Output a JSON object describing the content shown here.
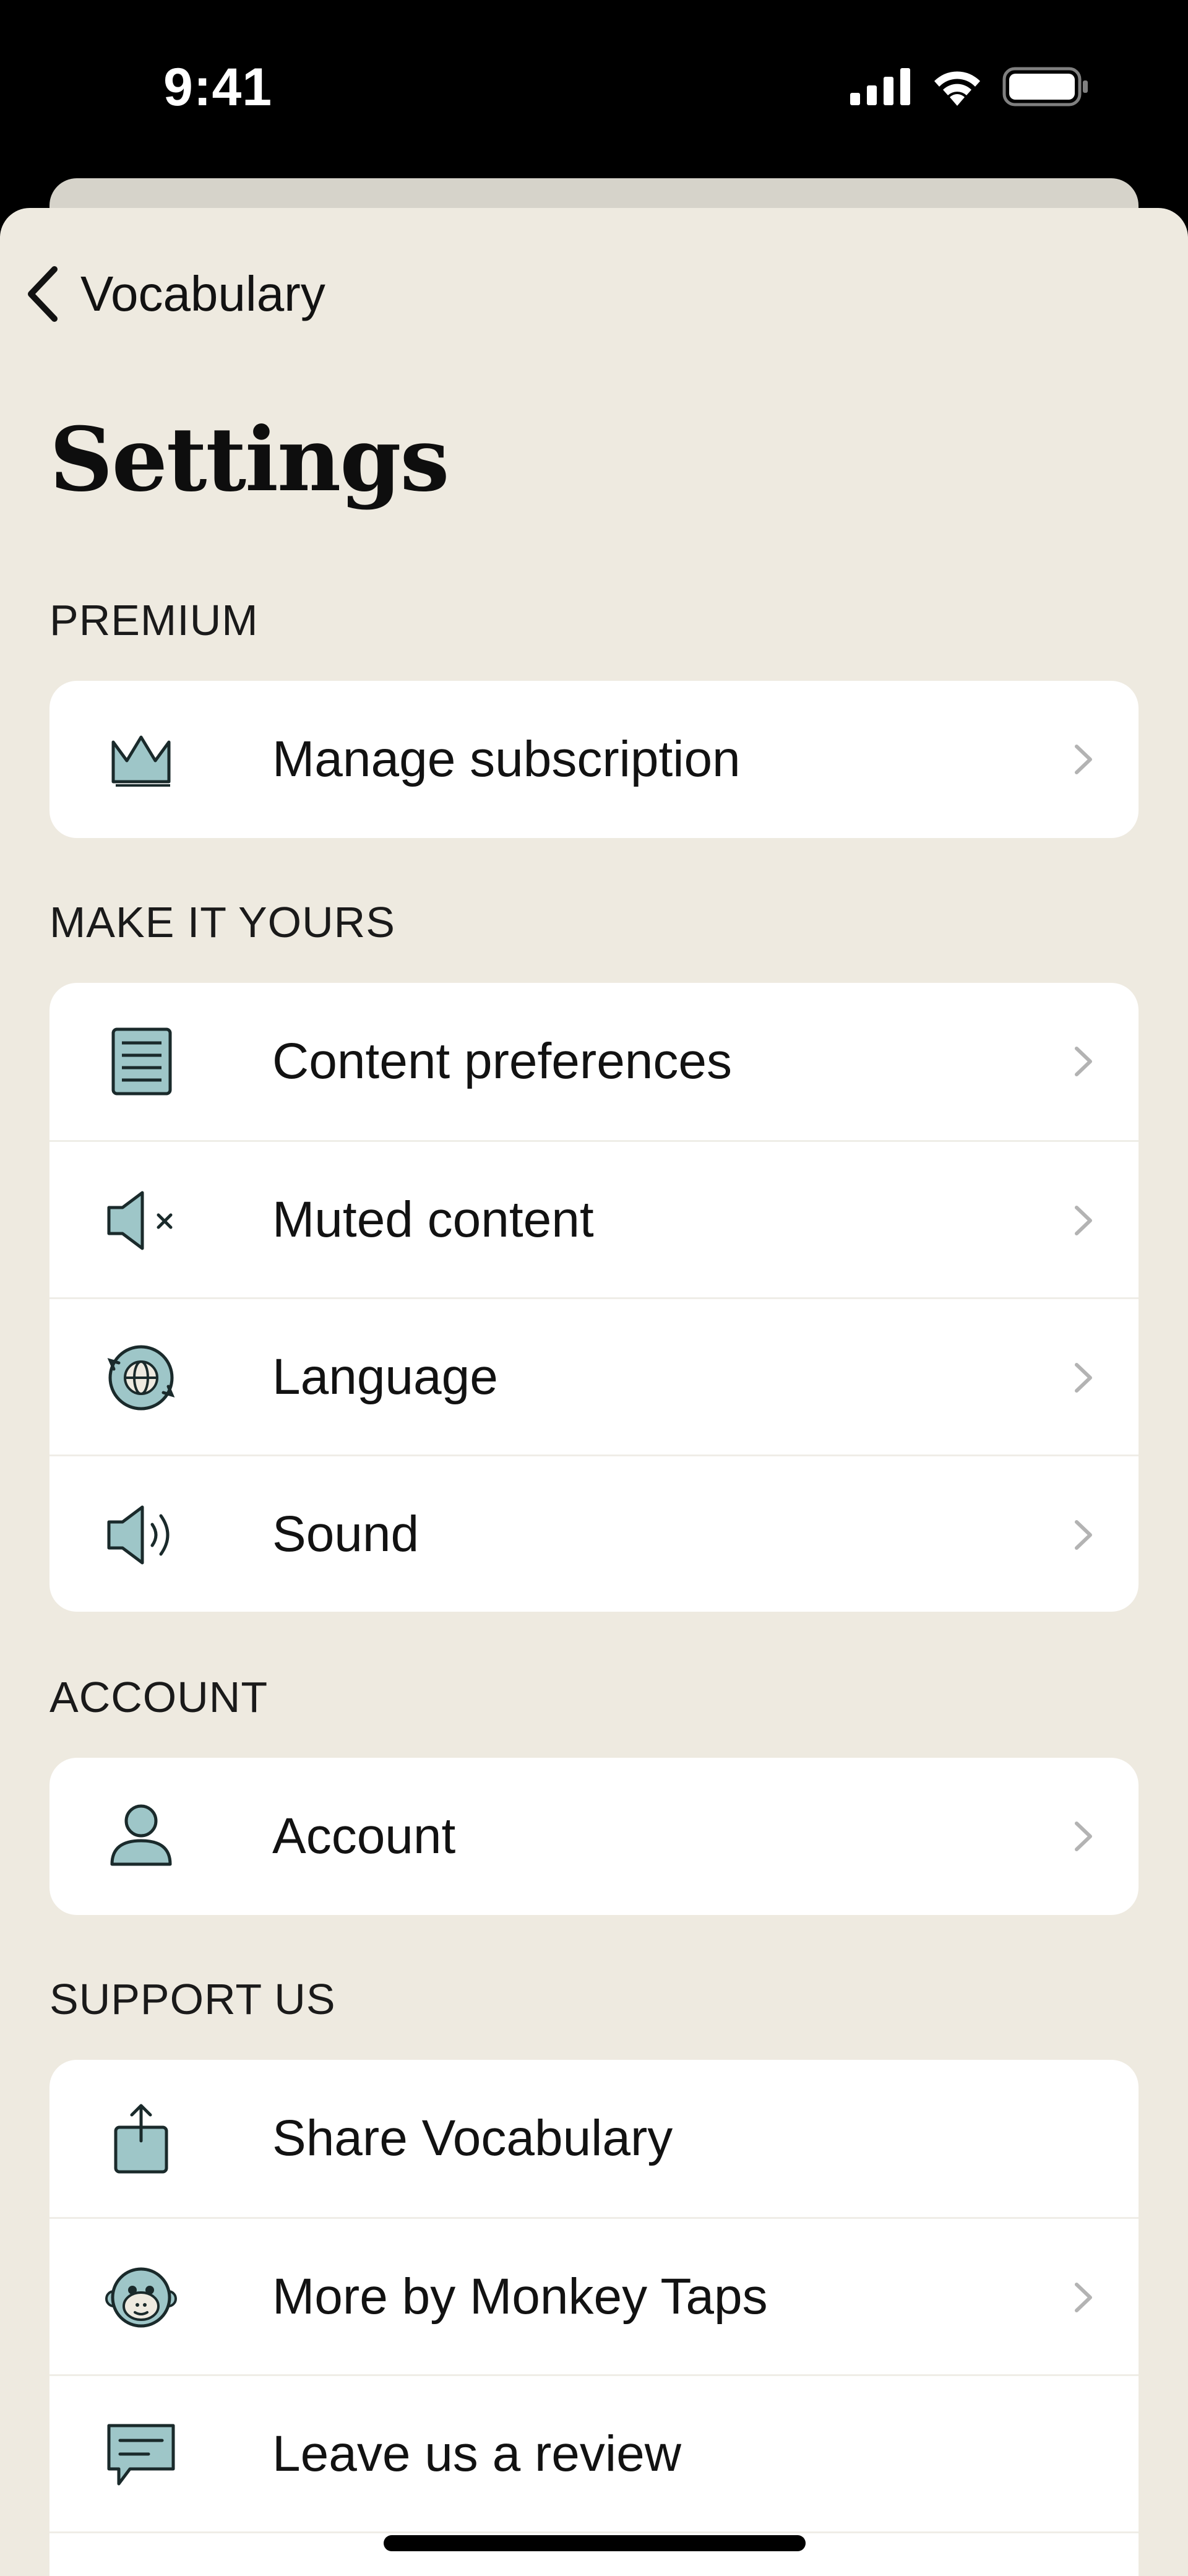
{
  "status_bar": {
    "time": "9:41",
    "icons": [
      "cellular-icon",
      "wifi-icon",
      "battery-icon"
    ]
  },
  "nav": {
    "back_label": "Vocabulary",
    "back_icon": "chevron-left-icon"
  },
  "page": {
    "title": "Settings"
  },
  "colors": {
    "background": "#eeeae0",
    "card": "#ffffff",
    "icon_fill": "#9ec6c8",
    "chevron": "#b3b3b3"
  },
  "sections": [
    {
      "header": "PREMIUM",
      "items": [
        {
          "label": "Manage subscription",
          "icon": "crown-icon",
          "chevron": true
        }
      ]
    },
    {
      "header": "MAKE IT YOURS",
      "items": [
        {
          "label": "Content preferences",
          "icon": "document-lines-icon",
          "chevron": true
        },
        {
          "label": "Muted content",
          "icon": "speaker-muted-icon",
          "chevron": true
        },
        {
          "label": "Language",
          "icon": "globe-icon",
          "chevron": true
        },
        {
          "label": "Sound",
          "icon": "speaker-sound-icon",
          "chevron": true
        }
      ]
    },
    {
      "header": "ACCOUNT",
      "items": [
        {
          "label": "Account",
          "icon": "person-icon",
          "chevron": true
        }
      ]
    },
    {
      "header": "SUPPORT US",
      "items": [
        {
          "label": "Share Vocabulary",
          "icon": "share-icon",
          "chevron": false
        },
        {
          "label": "More by Monkey Taps",
          "icon": "monkey-icon",
          "chevron": true
        },
        {
          "label": "Leave us a review",
          "icon": "chat-bubble-icon",
          "chevron": false
        }
      ]
    }
  ]
}
